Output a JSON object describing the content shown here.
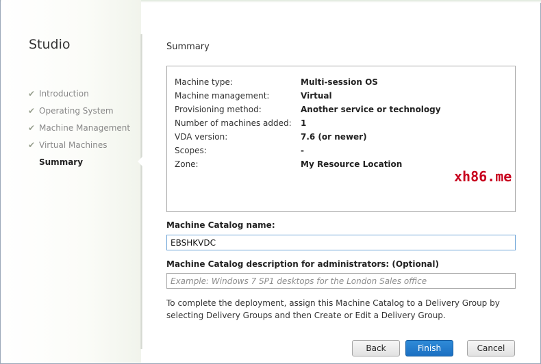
{
  "sidebar": {
    "title": "Studio",
    "steps": [
      {
        "label": "Introduction",
        "completed": true
      },
      {
        "label": "Operating System",
        "completed": true
      },
      {
        "label": "Machine Management",
        "completed": true
      },
      {
        "label": "Virtual Machines",
        "completed": true
      },
      {
        "label": "Summary",
        "completed": false,
        "current": true
      }
    ]
  },
  "main": {
    "title": "Summary",
    "summary_rows": [
      {
        "key": "Machine type:",
        "value": "Multi-session OS"
      },
      {
        "key": "Machine management:",
        "value": "Virtual"
      },
      {
        "key": "Provisioning method:",
        "value": "Another service or technology"
      },
      {
        "key": "Number of machines added:",
        "value": "1"
      },
      {
        "key": "VDA version:",
        "value": "7.6 (or newer)"
      },
      {
        "key": "Scopes:",
        "value": "-"
      },
      {
        "key": "Zone:",
        "value": "My Resource Location"
      }
    ],
    "catalog_name": {
      "label": "Machine Catalog name:",
      "value": "EBSHKVDC"
    },
    "catalog_description": {
      "label": "Machine Catalog description for administrators: (Optional)",
      "value": "",
      "placeholder": "Example: Windows 7 SP1 desktops for the London Sales office"
    },
    "info_text": "To complete the deployment, assign this Machine Catalog to a Delivery Group by selecting Delivery Groups and then Create or Edit a Delivery Group."
  },
  "buttons": {
    "back": "Back",
    "finish": "Finish",
    "cancel": "Cancel"
  },
  "watermark": "xh86.me",
  "colors": {
    "finish_button": "#1f78cc",
    "watermark": "#c8001e",
    "active_input_border": "#6fa6d8"
  }
}
